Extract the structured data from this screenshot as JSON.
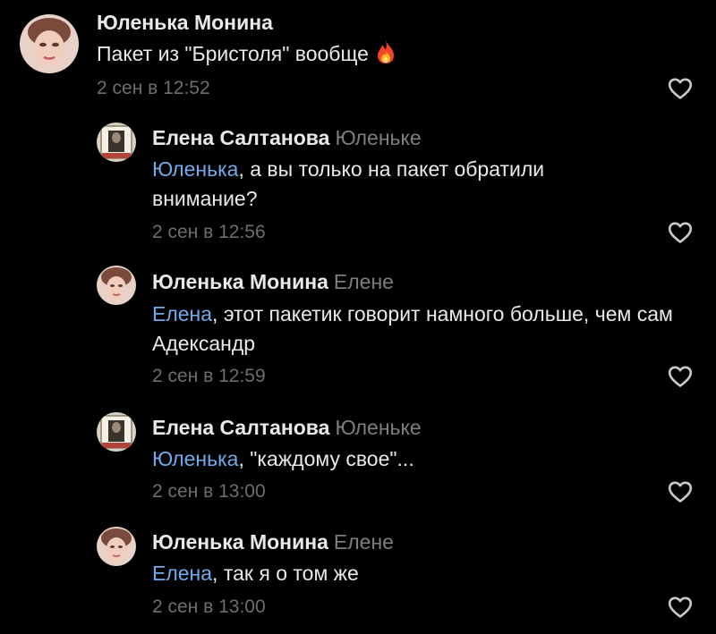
{
  "comments": [
    {
      "author": "Юленька Монина",
      "reply_to": "",
      "mention": "",
      "text": "Пакет из \"Бристоля\" вообще",
      "emoji": "fire-icon",
      "time": "2 сен в 12:52",
      "avatar": "woman"
    },
    {
      "author": "Елена Салтанова",
      "reply_to": "Юленьке",
      "mention": "Юленька",
      "text": ", а вы только на пакет обратили внимание?",
      "time": "2 сен в 12:56",
      "avatar": "photo"
    },
    {
      "author": "Юленька Монина",
      "reply_to": "Елене",
      "mention": "Елена",
      "text": ", этот пакетик говорит намного больше, чем сам Адександр",
      "time": "2 сен в 12:59",
      "avatar": "woman"
    },
    {
      "author": "Елена Салтанова",
      "reply_to": "Юленьке",
      "mention": "Юленька",
      "text": ", \"каждому свое\"...",
      "time": "2 сен в 13:00",
      "avatar": "photo"
    },
    {
      "author": "Юленька Монина",
      "reply_to": "Елене",
      "mention": "Елена",
      "text": ", так я о том же",
      "time": "2 сен в 13:00",
      "avatar": "woman"
    }
  ],
  "colors": {
    "background": "#000000",
    "text": "#e9e9ea",
    "secondary": "#7d7d82",
    "mention": "#71aaeb"
  }
}
